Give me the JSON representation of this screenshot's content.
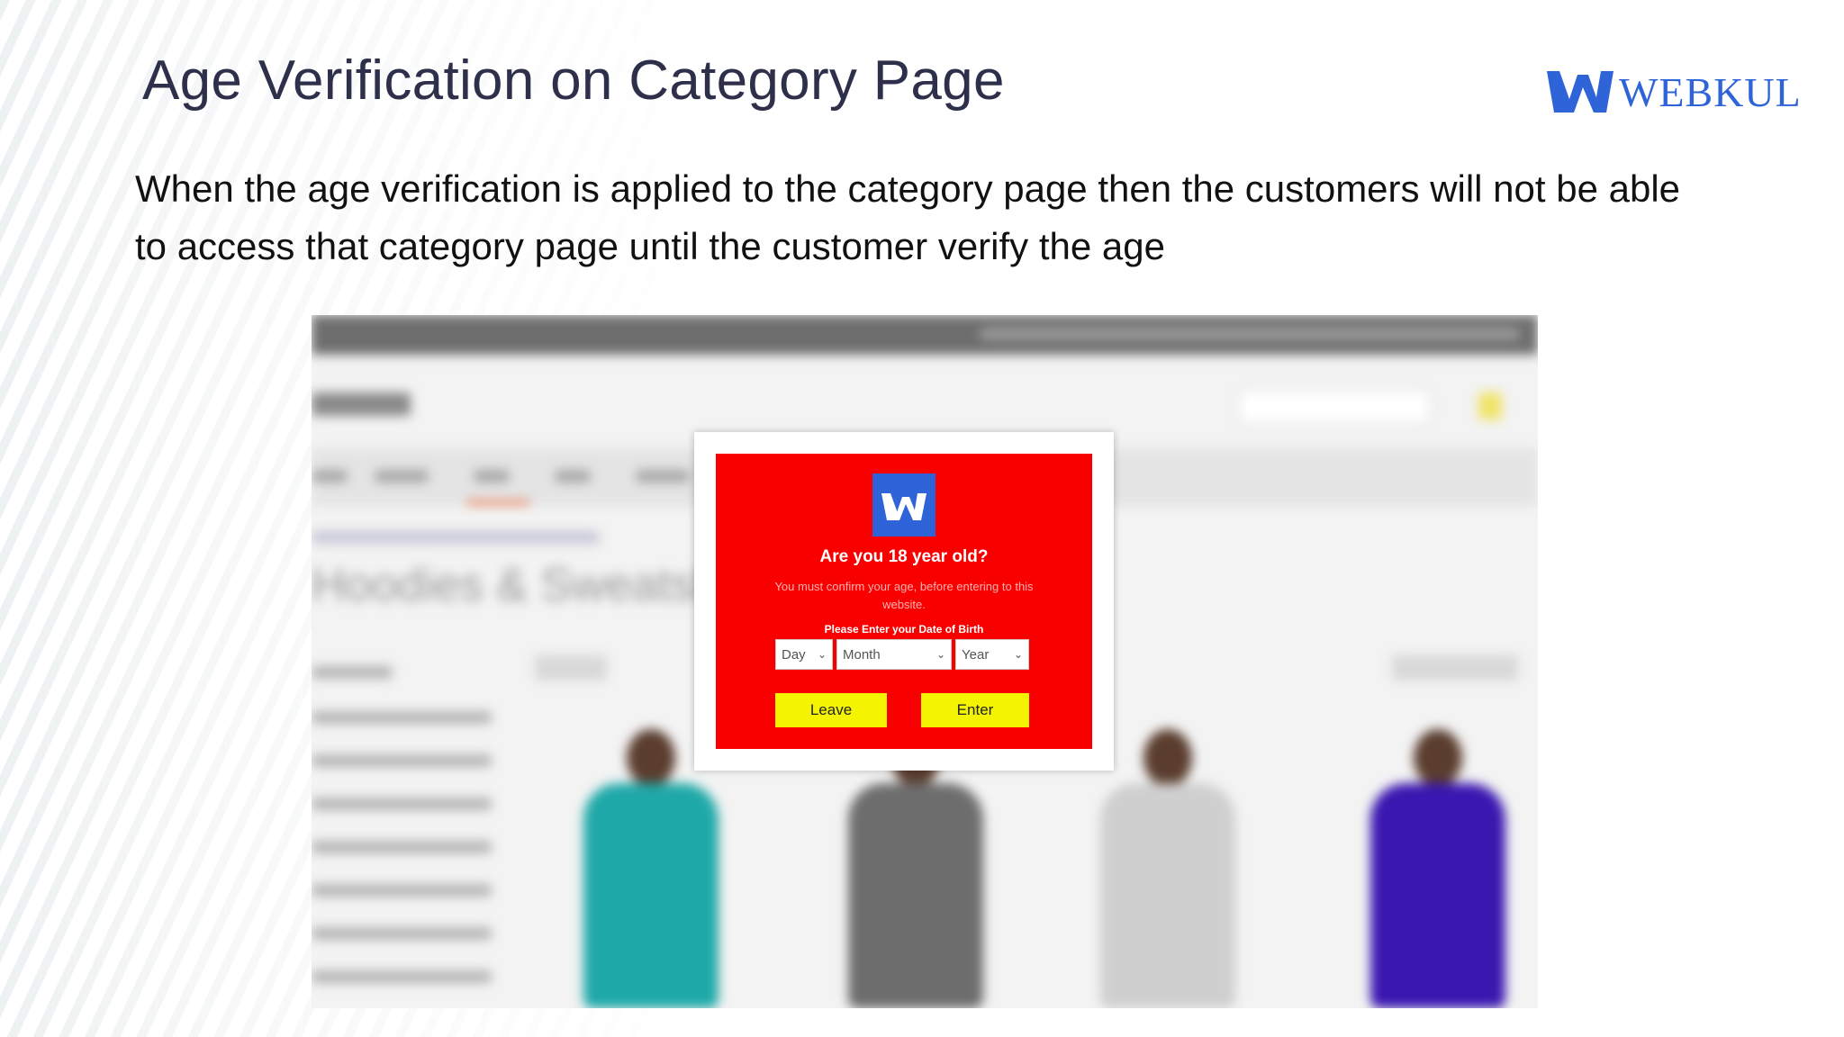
{
  "slide": {
    "title": "Age Verification on Category Page",
    "logo_text": "WEBKUL",
    "description": "When the age verification is applied to the category page then the customers will not be able to access that category page until the customer verify the age"
  },
  "screenshot": {
    "category_title": "Hoodies & Sweatshirts",
    "popup": {
      "title": "Are you 18 year old?",
      "subtitle": "You must confirm your age, before entering to this website.",
      "dob_label": "Please Enter your Date of Birth",
      "day_select": "Day",
      "month_select": "Month",
      "year_select": "Year",
      "leave_button": "Leave",
      "enter_button": "Enter"
    }
  },
  "colors": {
    "title": "#2e2f4a",
    "brand_blue": "#2f63d8",
    "popup_red": "#f80000",
    "button_yellow": "#f4f400"
  },
  "icons": {
    "logo": "webkul-logo-icon",
    "select_chevron": "chevron-down-icon"
  }
}
